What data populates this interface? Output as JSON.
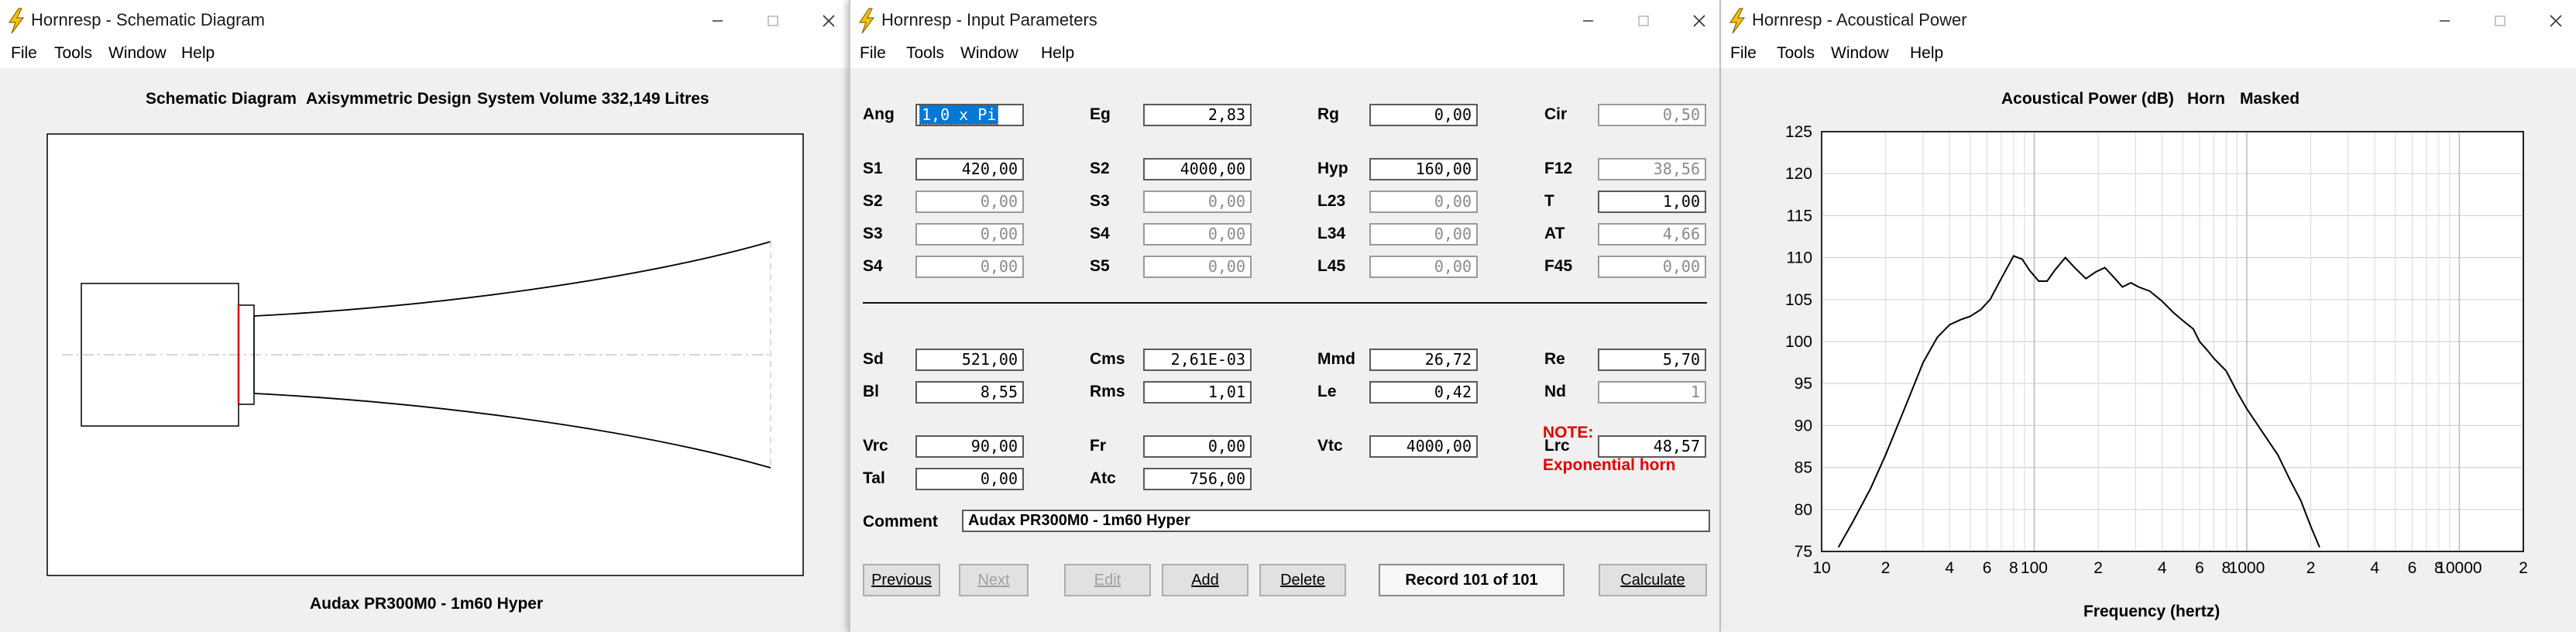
{
  "schematic_window": {
    "title": "Hornresp - Schematic Diagram",
    "menu": [
      "File",
      "Tools",
      "Window",
      "Help"
    ],
    "header_parts": [
      "Schematic Diagram",
      "Axisymmetric Design",
      "System Volume 332,149 Litres"
    ],
    "footer": "Audax PR300M0 - 1m60 Hyper"
  },
  "input_window": {
    "title": "Hornresp - Input Parameters",
    "menu": [
      "File",
      "Tools",
      "Window",
      "Help"
    ],
    "params": [
      {
        "label": "Ang",
        "value": "1,0 x Pi",
        "state": "selected"
      },
      {
        "label": "Eg",
        "value": "2,83",
        "state": "normal"
      },
      {
        "label": "Rg",
        "value": "0,00",
        "state": "normal"
      },
      {
        "label": "Cir",
        "value": "0,50",
        "state": "disabled"
      },
      {
        "label": "S1",
        "value": "420,00",
        "state": "normal"
      },
      {
        "label": "S2",
        "value": "4000,00",
        "state": "normal"
      },
      {
        "label": "Hyp",
        "value": "160,00",
        "state": "normal"
      },
      {
        "label": "F12",
        "value": "38,56",
        "state": "disabled"
      },
      {
        "label": "S2",
        "value": "0,00",
        "state": "disabled"
      },
      {
        "label": "S3",
        "value": "0,00",
        "state": "disabled"
      },
      {
        "label": "L23",
        "value": "0,00",
        "state": "disabled"
      },
      {
        "label": "T",
        "value": "1,00",
        "state": "normal"
      },
      {
        "label": "S3",
        "value": "0,00",
        "state": "disabled"
      },
      {
        "label": "S4",
        "value": "0,00",
        "state": "disabled"
      },
      {
        "label": "L34",
        "value": "0,00",
        "state": "disabled"
      },
      {
        "label": "AT",
        "value": "4,66",
        "state": "disabled"
      },
      {
        "label": "S4",
        "value": "0,00",
        "state": "disabled"
      },
      {
        "label": "S5",
        "value": "0,00",
        "state": "disabled"
      },
      {
        "label": "L45",
        "value": "0,00",
        "state": "disabled"
      },
      {
        "label": "F45",
        "value": "0,00",
        "state": "disabled"
      },
      {
        "label": "Sd",
        "value": "521,00",
        "state": "normal"
      },
      {
        "label": "Cms",
        "value": "2,61E-03",
        "state": "normal"
      },
      {
        "label": "Mmd",
        "value": "26,72",
        "state": "normal"
      },
      {
        "label": "Re",
        "value": "5,70",
        "state": "normal"
      },
      {
        "label": "Bl",
        "value": "8,55",
        "state": "normal"
      },
      {
        "label": "Rms",
        "value": "1,01",
        "state": "normal"
      },
      {
        "label": "Le",
        "value": "0,42",
        "state": "normal"
      },
      {
        "label": "Nd",
        "value": "1",
        "state": "disabled"
      },
      {
        "label": "Vrc",
        "value": "90,00",
        "state": "normal"
      },
      {
        "label": "Fr",
        "value": "0,00",
        "state": "normal"
      },
      {
        "label": "Vtc",
        "value": "4000,00",
        "state": "normal"
      },
      {
        "label": "Lrc",
        "value": "48,57",
        "state": "normal"
      },
      {
        "label": "Tal",
        "value": "0,00",
        "state": "normal"
      },
      {
        "label": "Atc",
        "value": "756,00",
        "state": "normal"
      }
    ],
    "note_label": "NOTE:",
    "note_text": "Exponential horn",
    "comment_label": "Comment",
    "comment_value": "Audax PR300M0 - 1m60 Hyper",
    "buttons": {
      "previous": "Previous",
      "next": "Next",
      "edit": "Edit",
      "add": "Add",
      "delete": "Delete",
      "record": "Record 101 of 101",
      "calculate": "Calculate"
    },
    "accent_color": "#e00000"
  },
  "power_window": {
    "title": "Hornresp - Acoustical Power",
    "menu": [
      "File",
      "Tools",
      "Window",
      "Help"
    ]
  },
  "chart_data": {
    "type": "line",
    "title_parts": [
      "Acoustical Power (dB)",
      "Horn",
      "Masked"
    ],
    "xlabel": "Frequency (hertz)",
    "ylabel": "",
    "x_scale": "log",
    "xlim": [
      10,
      20000
    ],
    "ylim": [
      75,
      125
    ],
    "grid": true,
    "y_ticks": [
      "125",
      "120",
      "115",
      "110",
      "105",
      "100",
      "95",
      "90",
      "85",
      "80",
      "75"
    ],
    "x_tick_labels": [
      {
        "x": 10,
        "label": "10"
      },
      {
        "x": 20,
        "label": "2"
      },
      {
        "x": 40,
        "label": "4"
      },
      {
        "x": 60,
        "label": "6"
      },
      {
        "x": 80,
        "label": "8"
      },
      {
        "x": 100,
        "label": "100"
      },
      {
        "x": 200,
        "label": "2"
      },
      {
        "x": 400,
        "label": "4"
      },
      {
        "x": 600,
        "label": "6"
      },
      {
        "x": 800,
        "label": "8"
      },
      {
        "x": 1000,
        "label": "1000"
      },
      {
        "x": 2000,
        "label": "2"
      },
      {
        "x": 4000,
        "label": "4"
      },
      {
        "x": 6000,
        "label": "6"
      },
      {
        "x": 8000,
        "label": "8"
      },
      {
        "x": 10000,
        "label": "10000"
      },
      {
        "x": 20000,
        "label": "2"
      }
    ],
    "series": [
      {
        "color": "#000000",
        "x": [
          12,
          14,
          17,
          20,
          25,
          30,
          35,
          40,
          45,
          50,
          56,
          62,
          70,
          80,
          88,
          95,
          105,
          115,
          125,
          140,
          155,
          175,
          195,
          215,
          240,
          260,
          285,
          310,
          350,
          400,
          450,
          500,
          560,
          600,
          650,
          700,
          800,
          900,
          1000,
          1200,
          1400,
          1600,
          1800,
          2000,
          2200
        ],
        "y": [
          75.5,
          78.5,
          82.5,
          86.5,
          92.5,
          97.5,
          100.5,
          102,
          102.6,
          103,
          103.8,
          105,
          107.5,
          110.2,
          109.8,
          108.5,
          107.2,
          107.2,
          108.5,
          110,
          108.8,
          107.5,
          108.3,
          108.8,
          107.5,
          106.5,
          107,
          106.5,
          106,
          104.8,
          103.5,
          102.5,
          101.5,
          100,
          99,
          98,
          96.5,
          94,
          92,
          89,
          86.5,
          83.5,
          81,
          78,
          75.5
        ]
      }
    ]
  }
}
